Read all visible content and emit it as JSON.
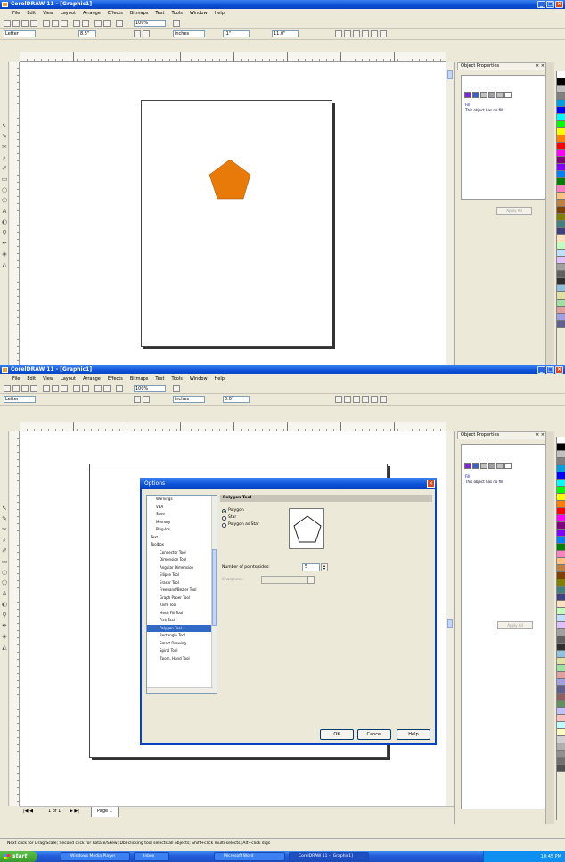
{
  "window_top": {
    "title": "CorelDRAW 11 - [Graphic1]",
    "menu": [
      "File",
      "Edit",
      "View",
      "Layout",
      "Arrange",
      "Effects",
      "Bitmaps",
      "Text",
      "Tools",
      "Window",
      "Help"
    ],
    "zoom": "100%",
    "paper_size": "Letter",
    "width": "8.5\"",
    "height": "11.0\"",
    "units": "inches",
    "angle": "0.0°",
    "nudge": ".1\"",
    "shape_color": "#e87a0a"
  },
  "window_bottom": {
    "title": "CorelDRAW 11 - [Graphic1]",
    "menu": [
      "File",
      "Edit",
      "View",
      "Layout",
      "Arrange",
      "Effects",
      "Bitmaps",
      "Text",
      "Tools",
      "Window",
      "Help"
    ],
    "zoom": "100%",
    "paper_size": "Letter",
    "units": "inches",
    "angle": "0.0°"
  },
  "docker": {
    "title": "Object Properties",
    "fill_link": "Fill",
    "message": "This object has no fill",
    "apply_label": "Apply All"
  },
  "dialog": {
    "title": "Options",
    "close": "×",
    "tree": [
      "Warnings",
      "VBA",
      "Save",
      "Memory",
      "Plug-Ins",
      "Text",
      "Toolbox",
      "Connector Tool",
      "Dimension Tool",
      "Angular Dimension",
      "Ellipse Tool",
      "Eraser Tool",
      "Freehand/Bezier Tool",
      "Graph Paper Tool",
      "Knife Tool",
      "Mesh Fill Tool",
      "Pick Tool",
      "Polygon Tool",
      "Rectangle Tool",
      "Smart Drawing",
      "Spiral Tool",
      "Zoom, Hand Tool"
    ],
    "selected_index": 17,
    "panel_title": "Polygon Tool",
    "options": [
      "Polygon",
      "Star",
      "Polygon as Star"
    ],
    "selected_option": 0,
    "points_label": "Number of points/sides:",
    "points_value": "5",
    "sharpness_label": "Sharpness:",
    "buttons": {
      "ok": "OK",
      "cancel": "Cancel",
      "help": "Help"
    }
  },
  "page_nav": {
    "position": "1 of 1",
    "tab": "Page 1"
  },
  "statusbar": {
    "text": "Next click for Drag/Scale; Second click for Rotate/Skew; Dbl-clicking tool selects all objects; Shift+click multi-selects; Alt+click digs"
  },
  "taskbar": {
    "start": "start",
    "tasks": [
      "Windows Media Player",
      "Inbox",
      "Microsoft Word",
      "CorelDRAW 11 - [Graphic1]"
    ],
    "clock": "10:45 PM"
  },
  "palette_colors": [
    "#ffffff",
    "#000000",
    "#c0c0c0",
    "#808080",
    "#00a0e0",
    "#0000ff",
    "#00ffff",
    "#00ff00",
    "#ffff00",
    "#ff8000",
    "#ff0000",
    "#ff00ff",
    "#800080",
    "#8000ff",
    "#0080ff",
    "#008000",
    "#ff80c0",
    "#ffc080",
    "#c08040",
    "#804000",
    "#808000",
    "#408080",
    "#404080",
    "#ffe0c0",
    "#c0ffc0",
    "#c0e0ff",
    "#e0c0ff",
    "#a0a0a0",
    "#606060",
    "#303030",
    "#90c0e0",
    "#e0e0a0",
    "#a0e0a0",
    "#e0a0a0",
    "#a0a0e0",
    "#606090",
    "#906060",
    "#609060",
    "#c0c0ff",
    "#ffc0c0",
    "#c0ffff",
    "#ffffc0",
    "#d0d0d0",
    "#b0b0b0",
    "#909090",
    "#707070",
    "#505050"
  ]
}
